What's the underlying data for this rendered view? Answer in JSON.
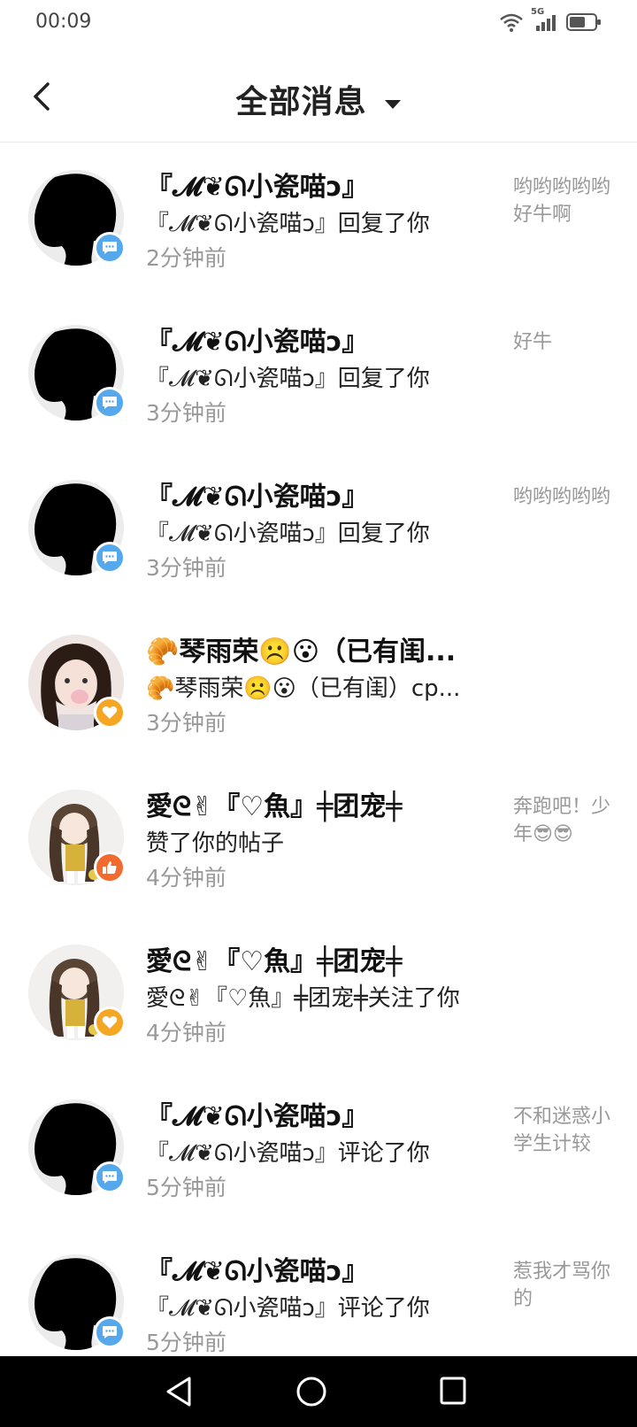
{
  "status_bar": {
    "time": "00:09",
    "signal_label": "5G"
  },
  "header": {
    "title": "全部消息"
  },
  "messages": [
    {
      "name": "『𝓜❦ᘏ小瓷喵ↄ』",
      "action": "『𝓜❦ᘏ小瓷喵ↄ』回复了你",
      "time": "2分钟前",
      "preview": "哟哟哟哟哟好牛啊",
      "badge": "blue"
    },
    {
      "name": "『𝓜❦ᘏ小瓷喵ↄ』",
      "action": "『𝓜❦ᘏ小瓷喵ↄ』回复了你",
      "time": "3分钟前",
      "preview": "好牛",
      "badge": "blue"
    },
    {
      "name": "『𝓜❦ᘏ小瓷喵ↄ』",
      "action": "『𝓜❦ᘏ小瓷喵ↄ』回复了你",
      "time": "3分钟前",
      "preview": "哟哟哟哟哟",
      "badge": "blue"
    },
    {
      "name": "🥐琴雨荣☹️😮（已有闺...",
      "action": "🥐琴雨荣☹️😮（已有闺）cp...",
      "time": "3分钟前",
      "preview": "",
      "badge": "orange"
    },
    {
      "name": "愛ᘓ✌『♡魚』╪团宠╪",
      "action": "赞了你的帖子",
      "time": "4分钟前",
      "preview": "奔跑吧！少年😎😎",
      "badge": "red"
    },
    {
      "name": "愛ᘓ✌『♡魚』╪团宠╪",
      "action": "愛ᘓ✌『♡魚』╪团宠╪关注了你",
      "time": "4分钟前",
      "preview": "",
      "badge": "orange"
    },
    {
      "name": "『𝓜❦ᘏ小瓷喵ↄ』",
      "action": "『𝓜❦ᘏ小瓷喵ↄ』评论了你",
      "time": "5分钟前",
      "preview": "不和迷惑小学生计较",
      "badge": "blue"
    },
    {
      "name": "『𝓜❦ᘏ小瓷喵ↄ』",
      "action": "『𝓜❦ᘏ小瓷喵ↄ』评论了你",
      "time": "5分钟前",
      "preview": "惹我才骂你的",
      "badge": "blue"
    }
  ],
  "colors": {
    "badge_blue": "#55a8ec",
    "badge_orange": "#f5a623",
    "badge_red": "#f26a2e",
    "nav_bg": "#000000"
  }
}
